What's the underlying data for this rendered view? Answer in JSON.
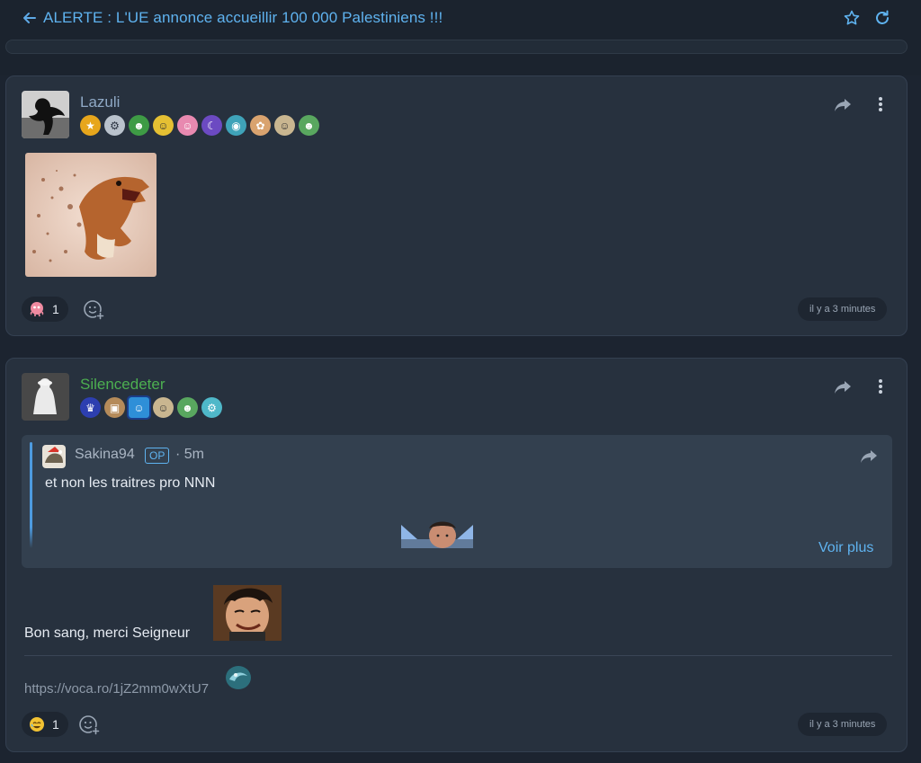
{
  "header": {
    "title": "ALERTE : L'UE annonce accueillir 100 000 Palestiniens !!!"
  },
  "posts": [
    {
      "username": "Lazuli",
      "username_color": "#8fa9c6",
      "badges": [
        "star-badge",
        "robot-badge",
        "elf-badge",
        "smiley-badge",
        "pink-girl-badge",
        "purple-alien-badge",
        "goggles-badge",
        "palette-badge",
        "face-badge",
        "bearded-man-badge"
      ],
      "reaction_count": "1",
      "timestamp": "il y a 3 minutes"
    },
    {
      "username": "Silencedeter",
      "username_color": "#4caf50",
      "badges": [
        "crown-badge",
        "cube-badge",
        "blue-smiley-badge",
        "face-badge",
        "bearded-man-badge",
        "robot-face-badge"
      ],
      "quote": {
        "author": "Sakina94",
        "op_label": "OP",
        "time": "· 5m",
        "text": "et non les traitres pro NNN",
        "more_label": "Voir plus"
      },
      "body_text": "Bon sang, merci Seigneur",
      "link_text": "https://voca.ro/1jZ2mm0wXtU7",
      "reaction_count": "1",
      "timestamp": "il y a 3 minutes"
    }
  ],
  "colors": {
    "accent": "#5fb3f0",
    "background": "#1c2430",
    "card": "#27313e"
  }
}
